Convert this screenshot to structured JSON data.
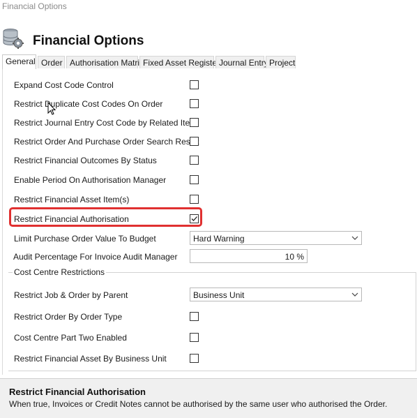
{
  "window": {
    "title": "Financial Options"
  },
  "header": {
    "title": "Financial Options",
    "icon": "database-gear-icon"
  },
  "tabs": [
    {
      "label": "General",
      "active": true
    },
    {
      "label": "Order",
      "active": false
    },
    {
      "label": "Authorisation Matrix",
      "active": false
    },
    {
      "label": "Fixed Asset Register",
      "active": false
    },
    {
      "label": "Journal Entry",
      "active": false
    },
    {
      "label": "Project",
      "active": false
    }
  ],
  "general": {
    "options": [
      {
        "label": "Expand Cost Code Control",
        "checked": false
      },
      {
        "label": "Restrict Duplicate Cost Codes On Order",
        "checked": false
      },
      {
        "label": "Restrict Journal Entry Cost Code by Related Item",
        "checked": false
      },
      {
        "label": "Restrict Order And Purchase Order Search Result",
        "checked": false
      },
      {
        "label": "Restrict Financial Outcomes By Status",
        "checked": false
      },
      {
        "label": "Enable Period On Authorisation Manager",
        "checked": false
      },
      {
        "label": "Restrict Financial Asset Item(s)",
        "checked": false
      },
      {
        "label": "Restrict Financial Authorisation",
        "checked": true
      }
    ],
    "limit_po": {
      "label": "Limit Purchase Order Value To Budget",
      "value": "Hard Warning"
    },
    "audit_pct": {
      "label": "Audit Percentage For Invoice Audit Manager",
      "value": "10 %"
    }
  },
  "cost_centre": {
    "title": "Cost Centre Restrictions",
    "job_order_parent": {
      "label": "Restrict Job & Order by Parent",
      "value": "Business Unit"
    },
    "options": [
      {
        "label": "Restrict Order By Order Type",
        "checked": false
      },
      {
        "label": "Cost Centre Part Two Enabled",
        "checked": false
      },
      {
        "label": "Restrict Financial Asset By Business Unit",
        "checked": false
      }
    ]
  },
  "help": {
    "title": "Restrict Financial Authorisation",
    "description": "When true, Invoices or Credit Notes cannot be authorised by the same user who authorised the Order."
  },
  "colors": {
    "highlight": "#e03030",
    "help_bg": "#f0f0f0"
  }
}
